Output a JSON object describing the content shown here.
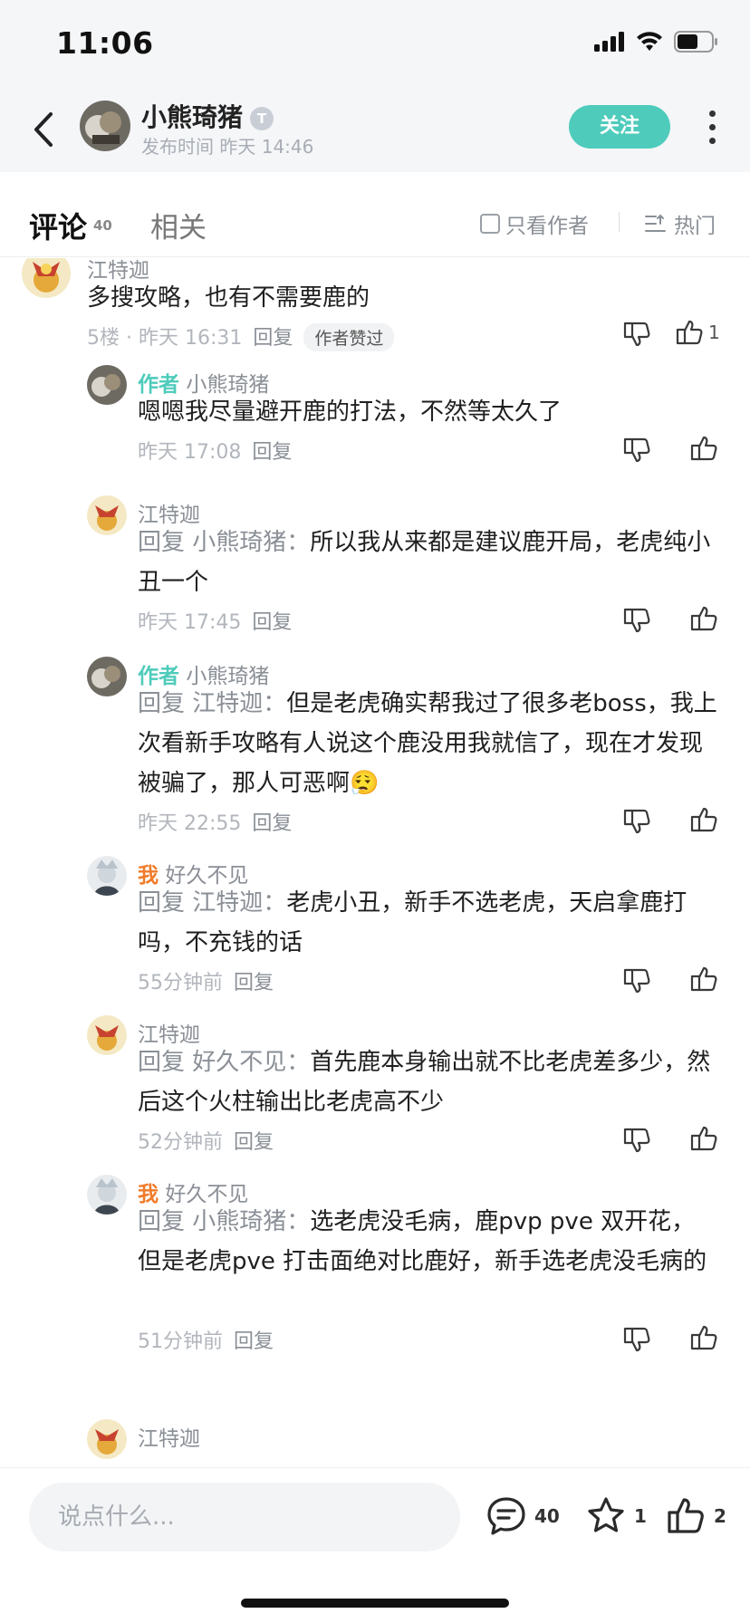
{
  "status": {
    "time": "11:06"
  },
  "header": {
    "author_name": "小熊琦猪",
    "level_badge": "T",
    "publish_time": "发布时间 昨天 14:46",
    "follow_label": "关注"
  },
  "tabs": {
    "comments_label": "评论",
    "comments_count": "40",
    "related_label": "相关",
    "only_author_label": "只看作者",
    "sort_label": "热门"
  },
  "comments": [
    {
      "author": "江特迦",
      "text": "多搜攻略，也有不需要鹿的",
      "meta": "5楼 · 昨天 16:31",
      "reply_label": "回复",
      "badge": "作者赞过",
      "like_count": "1"
    },
    {
      "tag": "作者",
      "author": "小熊琦猪",
      "text": "嗯嗯我尽量避开鹿的打法，不然等太久了",
      "meta": "昨天 17:08",
      "reply_label": "回复"
    },
    {
      "author": "江特迦",
      "reply_to": "回复 小熊琦猪：",
      "text": "所以我从来都是建议鹿开局，老虎纯小丑一个",
      "meta": "昨天 17:45",
      "reply_label": "回复"
    },
    {
      "tag": "作者",
      "author": "小熊琦猪",
      "reply_to": "回复 江特迦：",
      "text": "但是老虎确实帮我过了很多老boss，我上次看新手攻略有人说这个鹿没用我就信了，现在才发现被骗了，那人可恶啊😮‍💨",
      "meta": "昨天 22:55",
      "reply_label": "回复"
    },
    {
      "tag": "我",
      "author": "好久不见",
      "reply_to": "回复 江特迦：",
      "text": "老虎小丑，新手不选老虎，天启拿鹿打吗，不充钱的话",
      "meta": "55分钟前",
      "reply_label": "回复"
    },
    {
      "author": "江特迦",
      "reply_to": "回复 好久不见：",
      "text": "首先鹿本身输出就不比老虎差多少，然后这个火柱输出比老虎高不少",
      "meta": "52分钟前",
      "reply_label": "回复"
    },
    {
      "tag": "我",
      "author": "好久不见",
      "reply_to": "回复 小熊琦猪：",
      "text": "选老虎没毛病，鹿pvp pve 双开花，但是老虎pve 打击面绝对比鹿好，新手选老虎没毛病的",
      "meta": "51分钟前",
      "reply_label": "回复"
    },
    {
      "author": "江特迦"
    }
  ],
  "bottom": {
    "input_placeholder": "说点什么...",
    "comment_count": "40",
    "star_count": "1",
    "like_count": "2"
  },
  "colors": {
    "accent": "#4ecbbb",
    "me_tag": "#f07b2a"
  }
}
